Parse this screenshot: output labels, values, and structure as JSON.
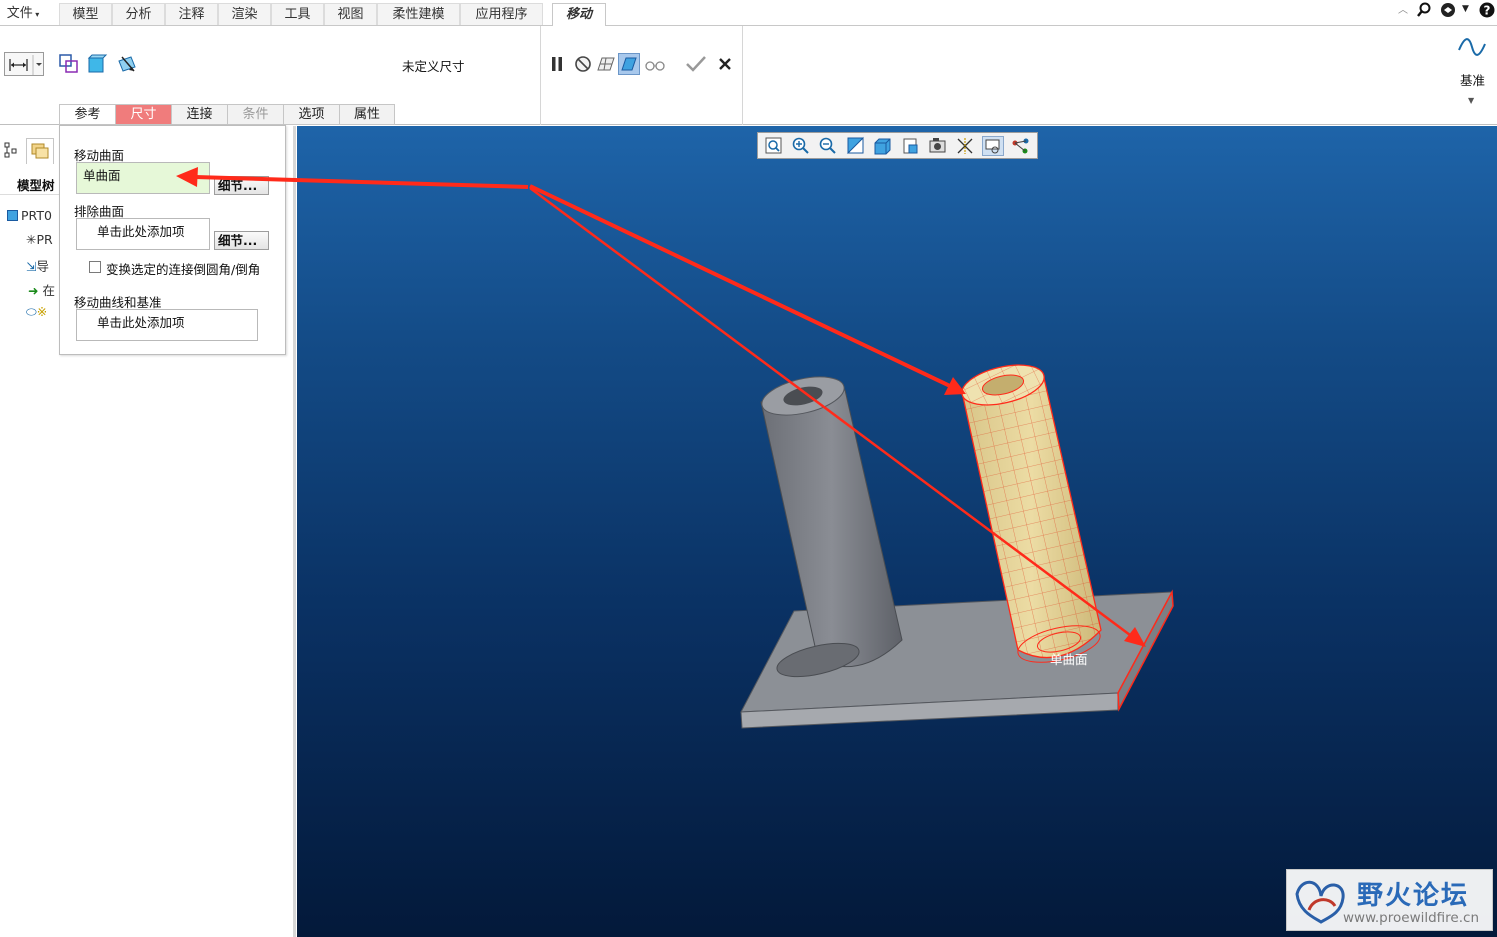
{
  "menubar": {
    "file": "文件",
    "tabs": [
      "模型",
      "分析",
      "注释",
      "渲染",
      "工具",
      "视图",
      "柔性建模",
      "应用程序"
    ],
    "active_tab": "移动"
  },
  "ribbon": {
    "dimension_status": "未定义尺寸",
    "datum_label": "基准"
  },
  "dashboard_tabs": [
    "参考",
    "尺寸",
    "连接",
    "条件",
    "选项",
    "属性"
  ],
  "references": {
    "move_surfaces_label": "移动曲面",
    "move_surfaces_value": "单曲面",
    "exclude_surfaces_label": "排除曲面",
    "exclude_surfaces_value": "单击此处添加项",
    "detail_button": "细节...",
    "transform_rounds_label": "变换选定的连接倒圆角/倒角",
    "move_curves_label": "移动曲线和基准",
    "move_curves_value": "单击此处添加项"
  },
  "model_tree": {
    "label": "模型树",
    "root": "PRT0",
    "items": [
      "PR",
      "导",
      "在",
      "※"
    ]
  },
  "viewport": {
    "surface_tag": "单曲面"
  },
  "watermark": {
    "title": "野火论坛",
    "url": "www.proewildfire.cn"
  },
  "colors": {
    "accent_red": "#f07c7c",
    "selection_red": "#ff2a1a",
    "highlight_yellow": "#e8d9a0",
    "viewport_top": "#1e64a9",
    "viewport_bottom": "#03193a"
  }
}
